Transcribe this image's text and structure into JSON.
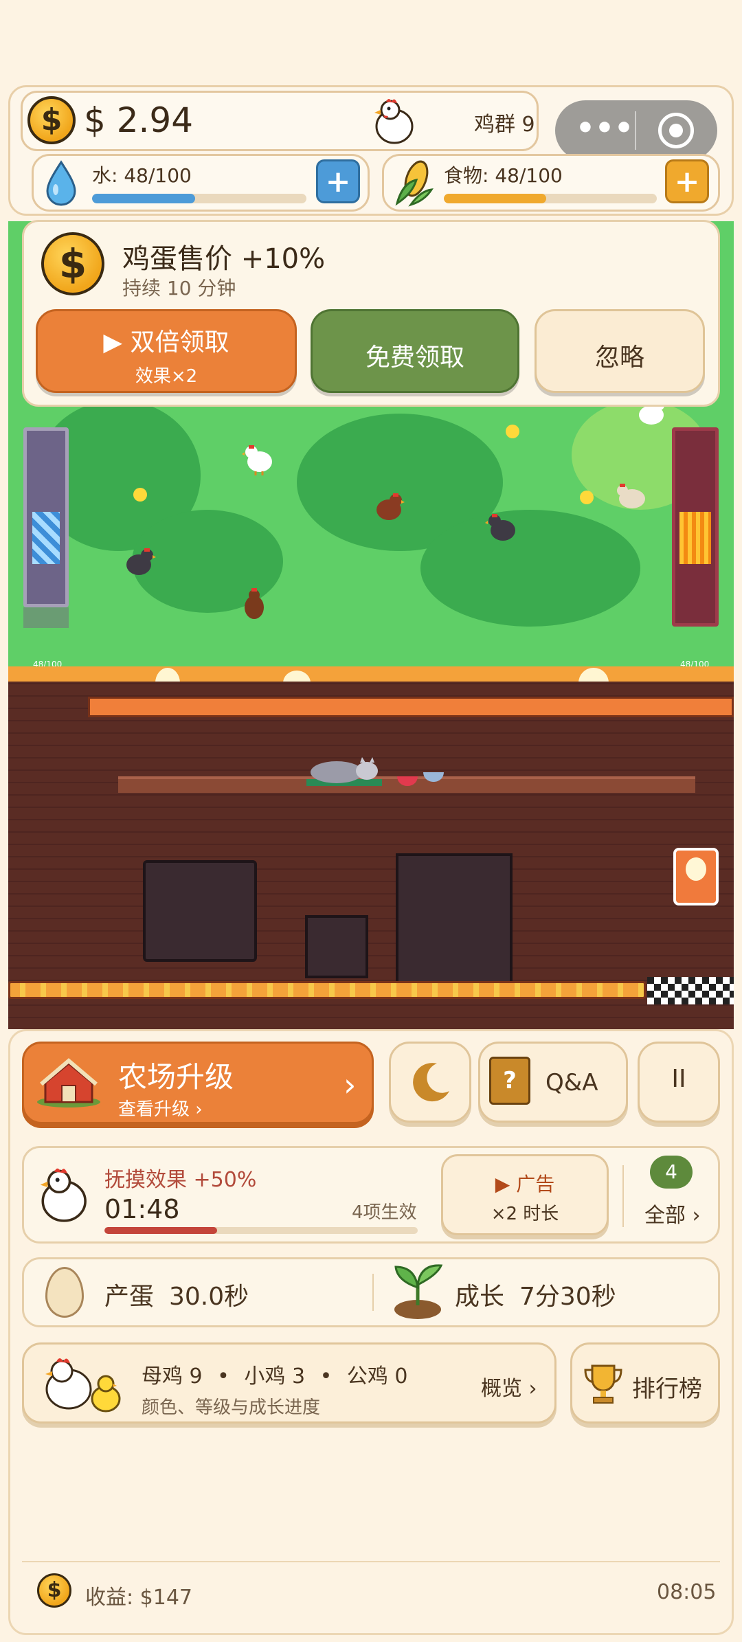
{
  "header": {
    "money": "$ 2.94",
    "flock_label": "鸡群 9",
    "water_label": "水: 48/100",
    "water_level": 0.48,
    "food_label": "食物: 48/100",
    "food_level": 0.48,
    "plus_symbol": "+",
    "water_color": "#4d9bd8",
    "food_color": "#f0a92d"
  },
  "bonus": {
    "title": "鸡蛋售价 +10%",
    "subtitle": "持续 10 分钟",
    "double_label": "▶ 双倍领取",
    "double_sub": "效果×2",
    "free_label": "免费领取",
    "ignore_label": "忽略"
  },
  "scene": {
    "left_tank_label": "48/100",
    "right_tank_label": "48/100"
  },
  "controls": {
    "upgrade_title": "农场升级",
    "upgrade_sub": "查看升级 ›",
    "upgrade_arrow": "›",
    "qa_label": "Q&A",
    "pause_label": "II"
  },
  "petting": {
    "title": "抚摸效果 +50%",
    "timer": "01:48",
    "timer_progress": 0.36,
    "active_count": "4项生效",
    "ad_label": "▶ 广告",
    "ad_sub": "×2 时长",
    "badge": "4",
    "all_label": "全部 ›"
  },
  "production": {
    "egg_label": "产蛋",
    "egg_value": "30.0秒",
    "growth_label": "成长",
    "growth_value": "7分30秒"
  },
  "flock": {
    "hens": "母鸡 9",
    "chicks": "小鸡 3",
    "roosters": "公鸡 0",
    "dot": "•",
    "sub": "颜色、等级与成长进度",
    "overview_label": "概览 ›",
    "rank_label": "排行榜"
  },
  "footer": {
    "income": "收益: $147",
    "time": "08:05"
  },
  "icons": {
    "coin": "$",
    "moon": "moon-icon",
    "book": "?"
  }
}
